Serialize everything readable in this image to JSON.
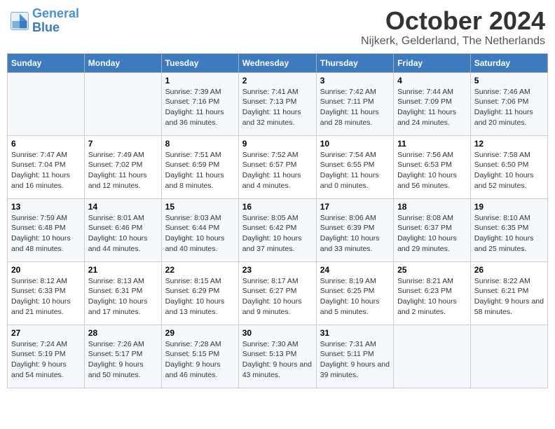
{
  "header": {
    "logo_line1": "General",
    "logo_line2": "Blue",
    "month": "October 2024",
    "location": "Nijkerk, Gelderland, The Netherlands"
  },
  "days_of_week": [
    "Sunday",
    "Monday",
    "Tuesday",
    "Wednesday",
    "Thursday",
    "Friday",
    "Saturday"
  ],
  "weeks": [
    [
      {
        "day": "",
        "info": ""
      },
      {
        "day": "",
        "info": ""
      },
      {
        "day": "1",
        "info": "Sunrise: 7:39 AM\nSunset: 7:16 PM\nDaylight: 11 hours and 36 minutes."
      },
      {
        "day": "2",
        "info": "Sunrise: 7:41 AM\nSunset: 7:13 PM\nDaylight: 11 hours and 32 minutes."
      },
      {
        "day": "3",
        "info": "Sunrise: 7:42 AM\nSunset: 7:11 PM\nDaylight: 11 hours and 28 minutes."
      },
      {
        "day": "4",
        "info": "Sunrise: 7:44 AM\nSunset: 7:09 PM\nDaylight: 11 hours and 24 minutes."
      },
      {
        "day": "5",
        "info": "Sunrise: 7:46 AM\nSunset: 7:06 PM\nDaylight: 11 hours and 20 minutes."
      }
    ],
    [
      {
        "day": "6",
        "info": "Sunrise: 7:47 AM\nSunset: 7:04 PM\nDaylight: 11 hours and 16 minutes."
      },
      {
        "day": "7",
        "info": "Sunrise: 7:49 AM\nSunset: 7:02 PM\nDaylight: 11 hours and 12 minutes."
      },
      {
        "day": "8",
        "info": "Sunrise: 7:51 AM\nSunset: 6:59 PM\nDaylight: 11 hours and 8 minutes."
      },
      {
        "day": "9",
        "info": "Sunrise: 7:52 AM\nSunset: 6:57 PM\nDaylight: 11 hours and 4 minutes."
      },
      {
        "day": "10",
        "info": "Sunrise: 7:54 AM\nSunset: 6:55 PM\nDaylight: 11 hours and 0 minutes."
      },
      {
        "day": "11",
        "info": "Sunrise: 7:56 AM\nSunset: 6:53 PM\nDaylight: 10 hours and 56 minutes."
      },
      {
        "day": "12",
        "info": "Sunrise: 7:58 AM\nSunset: 6:50 PM\nDaylight: 10 hours and 52 minutes."
      }
    ],
    [
      {
        "day": "13",
        "info": "Sunrise: 7:59 AM\nSunset: 6:48 PM\nDaylight: 10 hours and 48 minutes."
      },
      {
        "day": "14",
        "info": "Sunrise: 8:01 AM\nSunset: 6:46 PM\nDaylight: 10 hours and 44 minutes."
      },
      {
        "day": "15",
        "info": "Sunrise: 8:03 AM\nSunset: 6:44 PM\nDaylight: 10 hours and 40 minutes."
      },
      {
        "day": "16",
        "info": "Sunrise: 8:05 AM\nSunset: 6:42 PM\nDaylight: 10 hours and 37 minutes."
      },
      {
        "day": "17",
        "info": "Sunrise: 8:06 AM\nSunset: 6:39 PM\nDaylight: 10 hours and 33 minutes."
      },
      {
        "day": "18",
        "info": "Sunrise: 8:08 AM\nSunset: 6:37 PM\nDaylight: 10 hours and 29 minutes."
      },
      {
        "day": "19",
        "info": "Sunrise: 8:10 AM\nSunset: 6:35 PM\nDaylight: 10 hours and 25 minutes."
      }
    ],
    [
      {
        "day": "20",
        "info": "Sunrise: 8:12 AM\nSunset: 6:33 PM\nDaylight: 10 hours and 21 minutes."
      },
      {
        "day": "21",
        "info": "Sunrise: 8:13 AM\nSunset: 6:31 PM\nDaylight: 10 hours and 17 minutes."
      },
      {
        "day": "22",
        "info": "Sunrise: 8:15 AM\nSunset: 6:29 PM\nDaylight: 10 hours and 13 minutes."
      },
      {
        "day": "23",
        "info": "Sunrise: 8:17 AM\nSunset: 6:27 PM\nDaylight: 10 hours and 9 minutes."
      },
      {
        "day": "24",
        "info": "Sunrise: 8:19 AM\nSunset: 6:25 PM\nDaylight: 10 hours and 5 minutes."
      },
      {
        "day": "25",
        "info": "Sunrise: 8:21 AM\nSunset: 6:23 PM\nDaylight: 10 hours and 2 minutes."
      },
      {
        "day": "26",
        "info": "Sunrise: 8:22 AM\nSunset: 6:21 PM\nDaylight: 9 hours and 58 minutes."
      }
    ],
    [
      {
        "day": "27",
        "info": "Sunrise: 7:24 AM\nSunset: 5:19 PM\nDaylight: 9 hours and 54 minutes."
      },
      {
        "day": "28",
        "info": "Sunrise: 7:26 AM\nSunset: 5:17 PM\nDaylight: 9 hours and 50 minutes."
      },
      {
        "day": "29",
        "info": "Sunrise: 7:28 AM\nSunset: 5:15 PM\nDaylight: 9 hours and 46 minutes."
      },
      {
        "day": "30",
        "info": "Sunrise: 7:30 AM\nSunset: 5:13 PM\nDaylight: 9 hours and 43 minutes."
      },
      {
        "day": "31",
        "info": "Sunrise: 7:31 AM\nSunset: 5:11 PM\nDaylight: 9 hours and 39 minutes."
      },
      {
        "day": "",
        "info": ""
      },
      {
        "day": "",
        "info": ""
      }
    ]
  ]
}
